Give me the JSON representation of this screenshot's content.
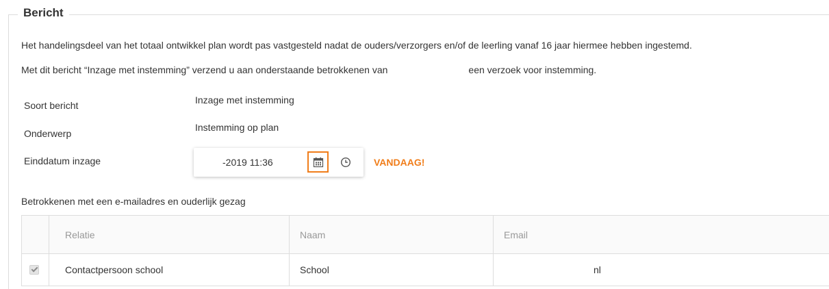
{
  "bericht": {
    "legend": "Bericht",
    "paragraph1": "Het handelingsdeel van het totaal ontwikkel plan wordt pas vastgesteld nadat de ouders/verzorgers en/of de leerling vanaf 16 jaar hiermee hebben ingestemd.",
    "paragraph2_part1": "Met dit bericht “Inzage met instemming” verzend u aan onderstaande betrokkenen van",
    "paragraph2_part2": "een verzoek voor instemming."
  },
  "form": {
    "soort_label": "Soort bericht",
    "soort_value": "Inzage met instemming",
    "onderwerp_label": "Onderwerp",
    "onderwerp_value": "Instemming op plan",
    "einddatum_label": "Einddatum inzage",
    "einddatum_value": "-2019 11:36",
    "calendar_icon": "calendar-icon",
    "clock_icon": "clock-icon",
    "today_link": "VANDAAG!",
    "accent_color": "#f07d1a"
  },
  "betrokkenen": {
    "title": "Betrokkenen met een e-mailadres en ouderlijk gezag",
    "columns": [
      "Relatie",
      "Naam",
      "Email"
    ],
    "rows": [
      {
        "checked": true,
        "relatie": "Contactpersoon school",
        "naam": "School",
        "email": "nl"
      }
    ]
  }
}
